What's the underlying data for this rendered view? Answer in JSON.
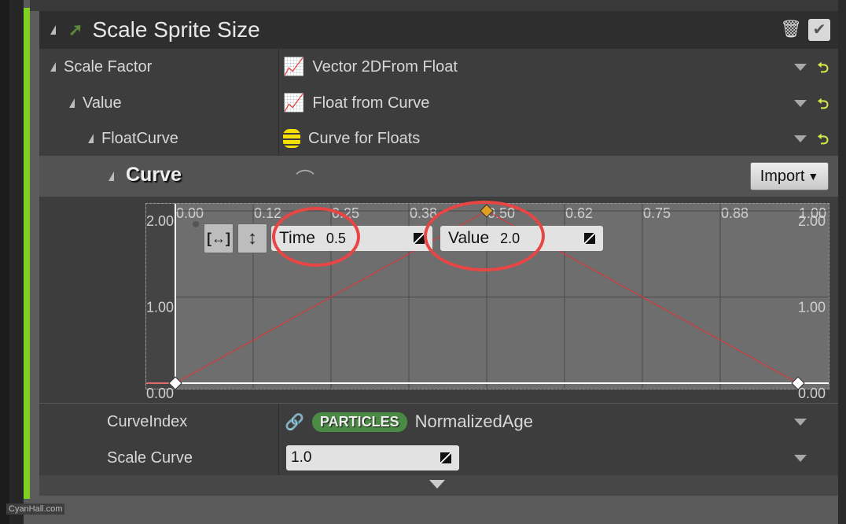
{
  "module": {
    "title": "Scale Sprite Size",
    "accent_color": "#7ed321"
  },
  "rows": [
    {
      "label": "Scale Factor",
      "value": "Vector 2DFrom Float",
      "icon": "curve-chart-icon"
    },
    {
      "label": "Value",
      "value": "Float from Curve",
      "icon": "curve-chart-icon"
    },
    {
      "label": "FloatCurve",
      "value": "Curve for Floats",
      "icon": "database-stack-icon"
    }
  ],
  "curve": {
    "label": "Curve",
    "import_label": "Import",
    "time_label": "Time",
    "time_value": "0.5",
    "value_label": "Value",
    "value_value": "2.0"
  },
  "curve_index": {
    "label": "CurveIndex",
    "badge": "PARTICLES",
    "value": "NormalizedAge"
  },
  "scale_curve": {
    "label": "Scale Curve",
    "value": "1.0"
  },
  "watermark": "CyanHall.com",
  "chart_data": {
    "type": "line",
    "x_ticks": [
      "0.00",
      "0.12",
      "0.25",
      "0.38",
      "0.50",
      "0.62",
      "0.75",
      "0.88",
      "1.00"
    ],
    "y_ticks": [
      "2.00",
      "1.00",
      "0.00"
    ],
    "xlim": [
      0,
      1
    ],
    "ylim": [
      0,
      2
    ],
    "grid": true,
    "series": [
      {
        "x": [
          0,
          0.5,
          1
        ],
        "y": [
          0,
          2,
          0
        ],
        "color": "#d63a3a"
      }
    ],
    "selected_key": {
      "x": 0.5,
      "y": 2.0,
      "color": "#e0a020"
    }
  }
}
